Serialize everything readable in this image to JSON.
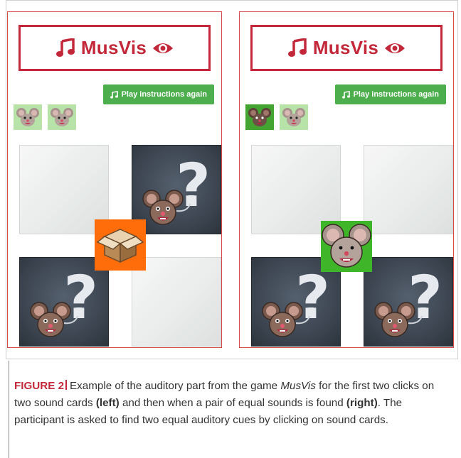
{
  "app": {
    "title": "MusVis",
    "accent_color": "#c3283a",
    "button_color": "#4cae4c"
  },
  "panels": [
    {
      "id": "left",
      "header_title": "MusVis",
      "play_button_label": "Play instructions again",
      "tokens": [
        {
          "icon": "mouse-icon",
          "state": "unfound"
        },
        {
          "icon": "mouse-icon",
          "state": "unfound"
        }
      ],
      "cards": [
        {
          "position": "top-left",
          "state": "blank"
        },
        {
          "position": "top-right",
          "state": "question-mouse"
        },
        {
          "position": "bottom-left",
          "state": "question-mouse"
        },
        {
          "position": "bottom-right",
          "state": "blank"
        }
      ],
      "center_tile": {
        "icon": "box-icon",
        "color": "#ff6d0a"
      }
    },
    {
      "id": "right",
      "header_title": "MusVis",
      "play_button_label": "Play instructions again",
      "tokens": [
        {
          "icon": "mouse-icon",
          "state": "found"
        },
        {
          "icon": "mouse-icon",
          "state": "unfound"
        }
      ],
      "cards": [
        {
          "position": "top-left",
          "state": "blank"
        },
        {
          "position": "top-right",
          "state": "blank"
        },
        {
          "position": "bottom-left",
          "state": "question-mouse"
        },
        {
          "position": "bottom-right",
          "state": "question-mouse"
        }
      ],
      "center_tile": {
        "icon": "mouse-icon",
        "color": "#3fb62a"
      }
    }
  ],
  "caption": {
    "label": "FIGURE 2",
    "t1": "Example of the auditory part from the game ",
    "game": "MusVis",
    "t2": " for the first two clicks on two sound cards ",
    "left": "(left)",
    "t3": " and then when a pair of equal sounds is found ",
    "right": "(right)",
    "t4": ". The participant is asked to find two equal auditory cues by clicking on sound cards."
  }
}
